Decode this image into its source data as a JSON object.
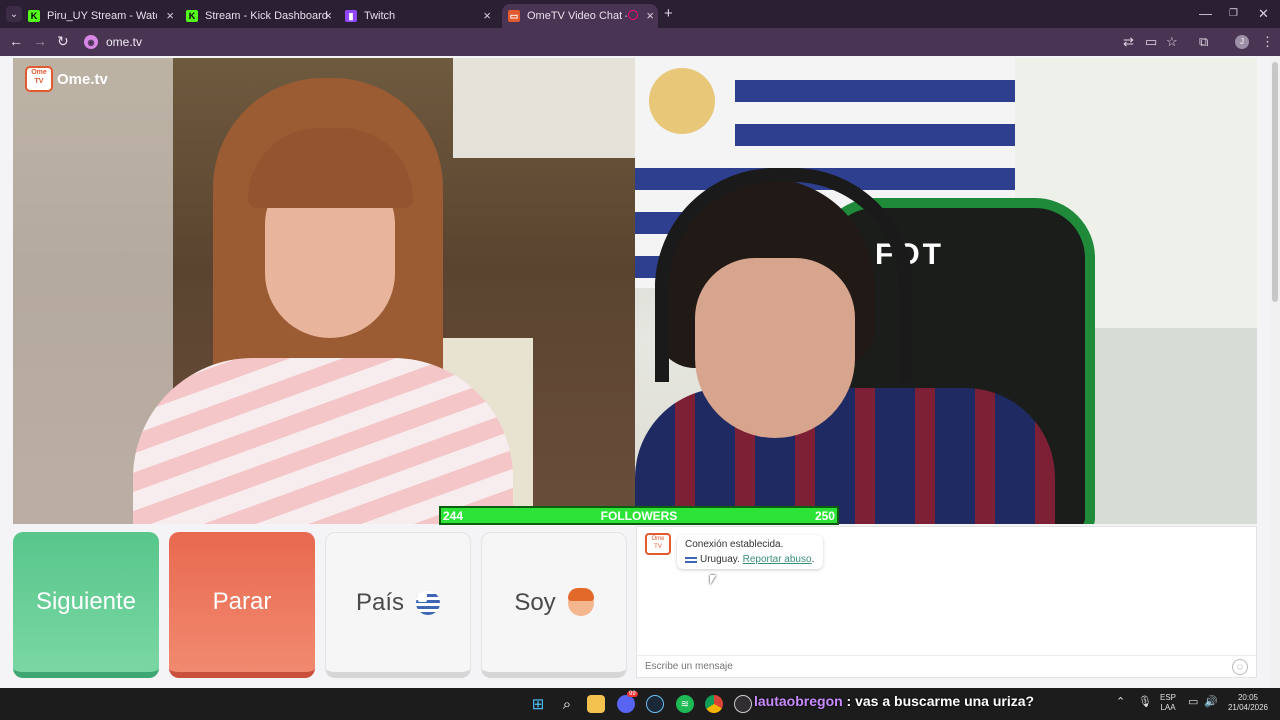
{
  "browser": {
    "tabs": [
      {
        "title": "Piru_UY Stream - Watch Live on",
        "icon": "kick-icon",
        "active": false
      },
      {
        "title": "Stream - Kick Dashboard",
        "icon": "kick-icon",
        "active": false
      },
      {
        "title": "Twitch",
        "icon": "twitch-icon",
        "active": false
      },
      {
        "title": "OmeTV Video Chat — Ome",
        "icon": "ometv-icon",
        "active": true
      }
    ],
    "url": "ome.tv",
    "new_tab": "+"
  },
  "site": {
    "logo_text": "Ome.tv",
    "logo_badge": "Ome TV"
  },
  "overlay": {
    "followers_current": "244",
    "followers_label": "FOLLOWERS",
    "followers_goal": "250",
    "followers_progress": 0.976,
    "chair_text": "FOT"
  },
  "buttons": {
    "next": "Siguiente",
    "stop": "Parar",
    "country": "País",
    "me": "Soy"
  },
  "chat": {
    "status": "Conexión establecida.",
    "country": "Uruguay.",
    "report": "Reportar abuso",
    "report_suffix": ".",
    "placeholder": "Escribe un mensaje"
  },
  "stream_chat": {
    "user": "lautaobregon",
    "message": " : vas a buscarme una uriza?"
  },
  "taskbar": {
    "lang": "ESP",
    "lang_sub": "LAA",
    "time": "20:05",
    "date": "21/04/2026",
    "discord_badge": "99"
  },
  "colors": {
    "next": "#58c68b",
    "stop": "#e8694f",
    "followers_bar": "#2ee337",
    "link": "#3a8f7a",
    "chat_user": "#c88bff"
  }
}
